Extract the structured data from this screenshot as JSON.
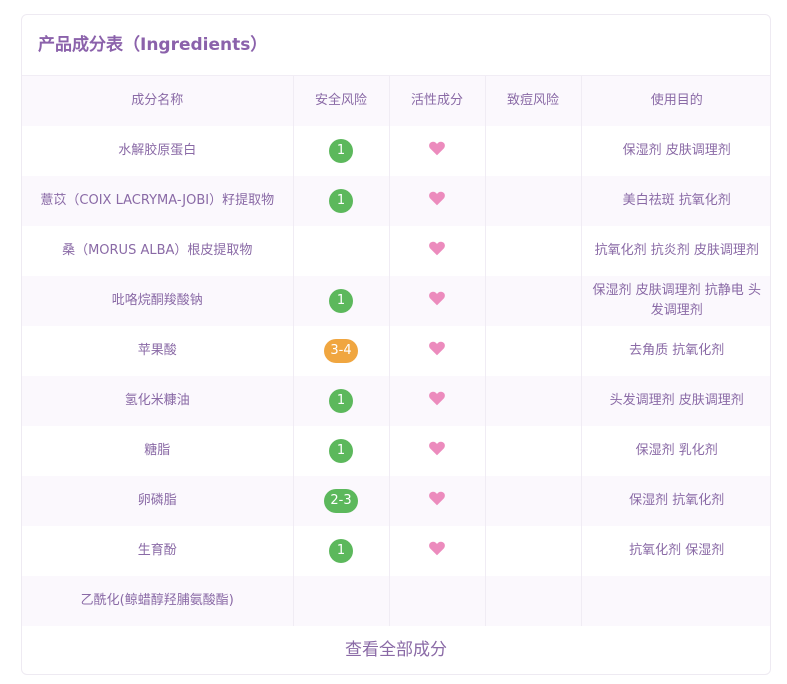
{
  "title": "产品成分表（Ingredients）",
  "colors": {
    "accent": "#8b62ab",
    "risk_low": "#5cb85c",
    "risk_mid": "#f0a640",
    "heart": "#ec8bbd"
  },
  "columns": [
    "成分名称",
    "安全风险",
    "活性成分",
    "致痘风险",
    "使用目的"
  ],
  "rows": [
    {
      "name": "水解胶原蛋白",
      "risk": "1",
      "level": "low",
      "active": true,
      "acne": "",
      "purpose": "保湿剂 皮肤调理剂"
    },
    {
      "name": "薏苡（COIX LACRYMA-JOBI）籽提取物",
      "risk": "1",
      "level": "low",
      "active": true,
      "acne": "",
      "purpose": "美白祛斑 抗氧化剂"
    },
    {
      "name": "桑（MORUS ALBA）根皮提取物",
      "risk": "",
      "level": "",
      "active": true,
      "acne": "",
      "purpose": "抗氧化剂 抗炎剂 皮肤调理剂"
    },
    {
      "name": "吡咯烷酮羧酸钠",
      "risk": "1",
      "level": "low",
      "active": true,
      "acne": "",
      "purpose": "保湿剂 皮肤调理剂 抗静电 头发调理剂"
    },
    {
      "name": "苹果酸",
      "risk": "3-4",
      "level": "mid",
      "active": true,
      "acne": "",
      "purpose": "去角质 抗氧化剂"
    },
    {
      "name": "氢化米糠油",
      "risk": "1",
      "level": "low",
      "active": true,
      "acne": "",
      "purpose": "头发调理剂 皮肤调理剂"
    },
    {
      "name": "糖脂",
      "risk": "1",
      "level": "low",
      "active": true,
      "acne": "",
      "purpose": "保湿剂 乳化剂"
    },
    {
      "name": "卵磷脂",
      "risk": "2-3",
      "level": "low",
      "active": true,
      "acne": "",
      "purpose": "保湿剂 抗氧化剂"
    },
    {
      "name": "生育酚",
      "risk": "1",
      "level": "low",
      "active": true,
      "acne": "",
      "purpose": "抗氧化剂 保湿剂"
    },
    {
      "name": "乙酰化(鲸蜡醇羟脯氨酸酯)",
      "risk": "",
      "level": "",
      "active": false,
      "acne": "",
      "purpose": ""
    }
  ],
  "footer": "查看全部成分"
}
